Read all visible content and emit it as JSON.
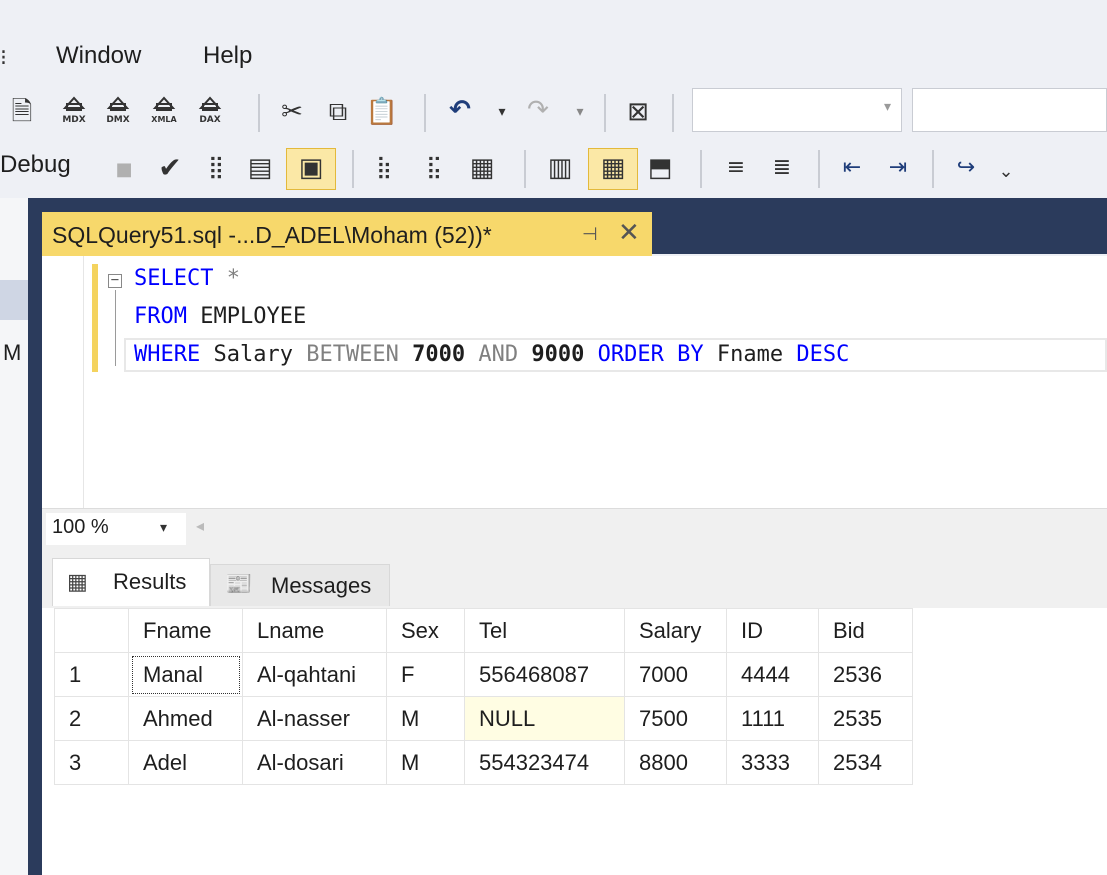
{
  "menu": {
    "items": [
      "Window",
      "Help"
    ]
  },
  "toolbar1": {
    "icons": [
      "query-icon",
      "mdx-query-icon",
      "dmx-query-icon",
      "xmla-query-icon",
      "dax-query-icon",
      "cut-icon",
      "copy-icon",
      "paste-icon",
      "undo-icon",
      "redo-icon",
      "window-icon"
    ],
    "icon_labels": {
      "mdx": "MDX",
      "dmx": "DMX",
      "xmla": "XMLA",
      "dax": "DAX"
    }
  },
  "toolbar2": {
    "debug_label": "Debug"
  },
  "editor_tab": {
    "title": "SQLQuery51.sql -...D_ADEL\\Moham (52))*"
  },
  "left_panel": {
    "letter": "M"
  },
  "code": {
    "line1": {
      "kw": "SELECT",
      "rest": " *"
    },
    "line2": {
      "kw": "FROM",
      "rest": " EMPLOYEE"
    },
    "line3": {
      "where": "WHERE",
      "col": " Salary ",
      "between": "BETWEEN",
      "v1": " 7000 ",
      "and": "AND",
      "v2": " 9000 ",
      "order": "ORDER BY",
      "fname": " Fname ",
      "desc": "DESC"
    }
  },
  "zoom": {
    "value": "100 %"
  },
  "results_tabs": {
    "results": "Results",
    "messages": "Messages"
  },
  "grid": {
    "columns": [
      "",
      "Fname",
      "Lname",
      "Sex",
      "Tel",
      "Salary",
      "ID",
      "Bid"
    ],
    "rows": [
      [
        "1",
        "Manal",
        "Al-qahtani",
        "F",
        "556468087",
        "7000",
        "4444",
        "2536"
      ],
      [
        "2",
        "Ahmed",
        "Al-nasser",
        "M",
        "NULL",
        "7500",
        "1111",
        "2535"
      ],
      [
        "3",
        "Adel",
        "Al-dosari",
        "M",
        "554323474",
        "8800",
        "3333",
        "2534"
      ]
    ]
  }
}
